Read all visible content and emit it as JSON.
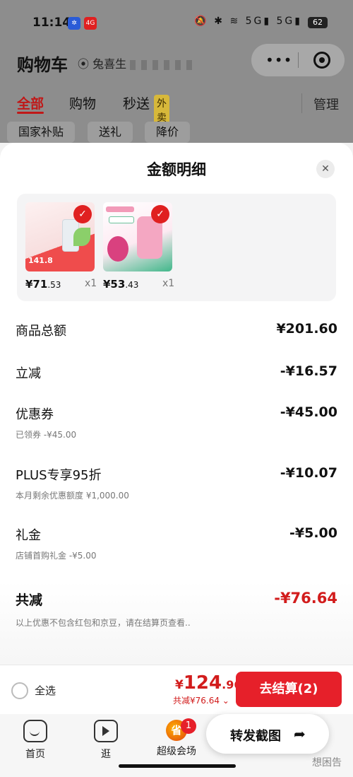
{
  "status_bar": {
    "time": "11:14",
    "app_badges": [
      {
        "icon": "app-blue-icon",
        "color": "#2a5bd7"
      },
      {
        "icon": "app-red-icon",
        "label": "4G",
        "color": "#e02020"
      }
    ],
    "icons": "🔕 ✱ ≋ 5G▮ 5G▮",
    "battery": "62"
  },
  "header": {
    "title": "购物车",
    "location": "兔喜生",
    "tabs": [
      {
        "label": "全部",
        "active": true
      },
      {
        "label": "购物",
        "active": false
      },
      {
        "label": "秒送",
        "active": false
      }
    ],
    "waimai_tag": "外卖",
    "manage": "管理",
    "filters": [
      "国家补贴",
      "送礼",
      "降价"
    ]
  },
  "sheet": {
    "title": "金额明细",
    "products": [
      {
        "price_int": "¥71",
        "price_dec": ".53",
        "qty": "x1",
        "thumb_text": "141.8",
        "colors": [
          "#fbeaea",
          "#ef5a5a"
        ]
      },
      {
        "price_int": "¥53",
        "price_dec": ".43",
        "qty": "x1",
        "thumb_text": "",
        "colors": [
          "#fde9f1",
          "#d9417f"
        ]
      }
    ],
    "rows": [
      {
        "label": "商品总额",
        "value": "¥201.60",
        "sub": ""
      },
      {
        "label": "立减",
        "value": "-¥16.57",
        "sub": ""
      },
      {
        "label": "优惠券",
        "value": "-¥45.00",
        "sub": "已领券 -¥45.00"
      },
      {
        "label": "PLUS专享95折",
        "value": "-¥10.07",
        "sub": "本月剩余优惠额度 ¥1,000.00"
      },
      {
        "label": "礼金",
        "value": "-¥5.00",
        "sub": "店铺首购礼金 -¥5.00"
      }
    ],
    "total": {
      "label": "共减",
      "value": "-¥76.64"
    },
    "note": "以上优惠不包含红包和京豆，请在结算页查看.."
  },
  "bottom_bar": {
    "select_all": "全选",
    "pay_yen": "¥",
    "pay_int": "124",
    "pay_dec": ".96",
    "discount": "共减¥76.64 ⌄",
    "checkout": "去结算(2)"
  },
  "tabbar": {
    "items": [
      {
        "label": "首页",
        "icon": "home-icon"
      },
      {
        "label": "逛",
        "icon": "play-icon"
      },
      {
        "label": "超级会场",
        "icon": "super-venue-icon",
        "badge": "1",
        "icon_text": "省"
      }
    ]
  },
  "forward": {
    "label": "转发截图",
    "icon": "share-arrow-icon"
  },
  "watermark": "想困告",
  "colors": {
    "accent": "#e6202a",
    "price": "#d21c1c",
    "overlay": "#8d8d8d"
  }
}
